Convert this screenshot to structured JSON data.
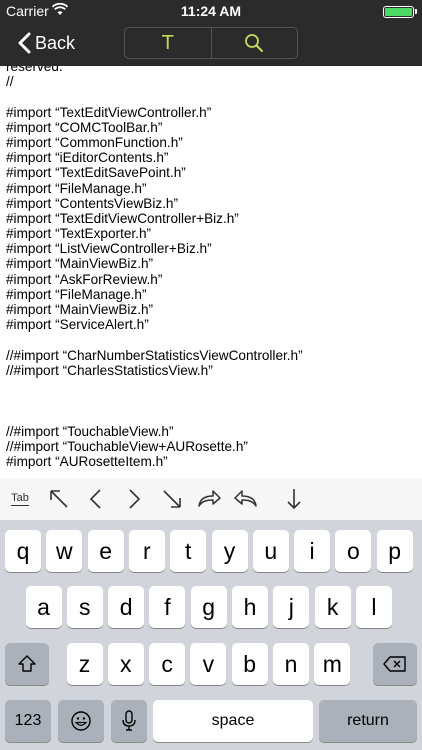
{
  "status_bar": {
    "carrier": "Carrier",
    "time": "11:24 AM"
  },
  "nav": {
    "back_label": "Back",
    "seg_text": "T"
  },
  "editor": {
    "lines": [
      "reserved.",
      "//",
      "",
      "#import “TextEditViewController.h”",
      "#import “COMCToolBar.h”",
      "#import “CommonFunction.h”",
      "#import “iEditorContents.h”",
      "#import “TextEditSavePoint.h”",
      "#import “FileManage.h”",
      "#import “ContentsViewBiz.h”",
      "#import “TextEditViewController+Biz.h”",
      "#import “TextExporter.h”",
      "#import “ListViewController+Biz.h”",
      "#import “MainViewBiz.h”",
      "#import “AskForReview.h”",
      "#import “FileManage.h”",
      "#import “MainViewBiz.h”",
      "#import “ServiceAlert.h”",
      "",
      "//#import “CharNumberStatisticsViewController.h”",
      "//#import “CharlesStatisticsView.h”",
      "",
      "",
      "",
      "//#import “TouchableView.h”",
      "//#import “TouchableView+AURosette.h”",
      "#import “AURosetteItem.h”"
    ]
  },
  "accessory": {
    "tab_label": "Tab"
  },
  "keyboard": {
    "row1": [
      "q",
      "w",
      "e",
      "r",
      "t",
      "y",
      "u",
      "i",
      "o",
      "p"
    ],
    "row2": [
      "a",
      "s",
      "d",
      "f",
      "g",
      "h",
      "j",
      "k",
      "l"
    ],
    "row3": [
      "z",
      "x",
      "c",
      "v",
      "b",
      "n",
      "m"
    ],
    "numbers_label": "123",
    "space_label": "space",
    "return_label": "return"
  },
  "colors": {
    "accent": "#c9d85d",
    "nav_bg": "#2b2b2b",
    "battery": "#4cd964"
  }
}
